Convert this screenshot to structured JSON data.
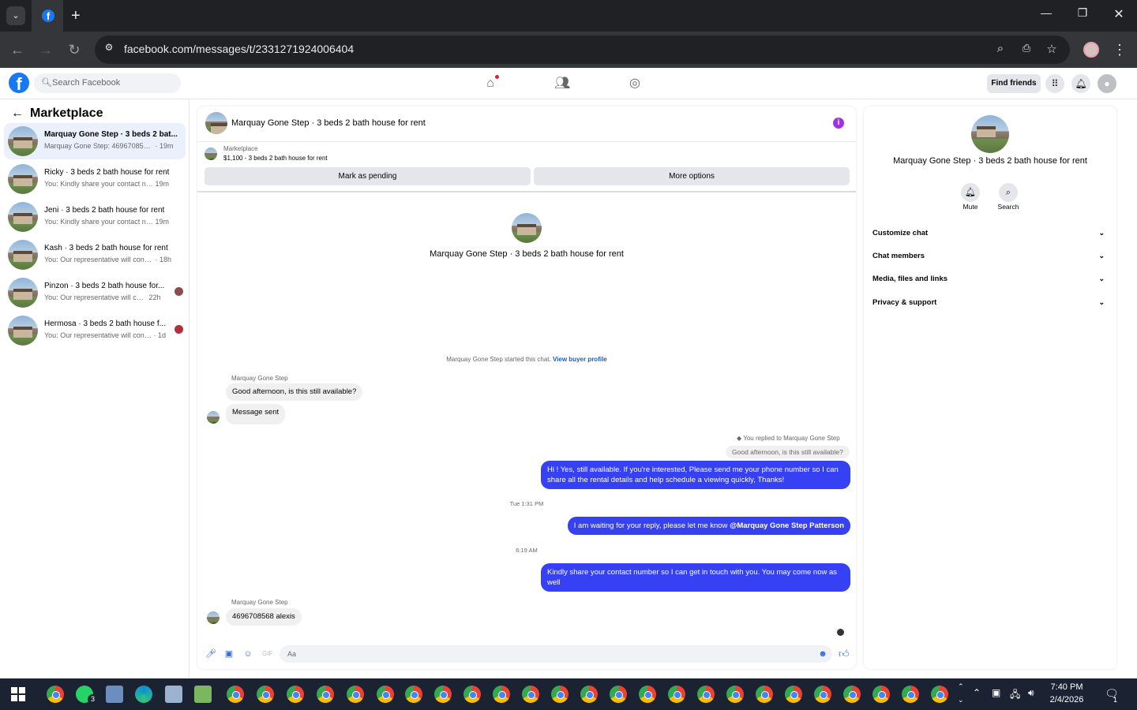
{
  "browser": {
    "url": "facebook.com/messages/t/2331271924006404"
  },
  "facebook": {
    "search_placeholder": "Search Facebook",
    "find_friends": "Find friends"
  },
  "sidebar": {
    "title": "Marketplace",
    "conversations": [
      {
        "name": "Marquay Gone Step · 3 beds 2 bat...",
        "preview": "Marquay Gone Step: 4696708568 al...",
        "time": "· 19m",
        "active": true
      },
      {
        "name": "Ricky · 3 beds 2 bath house for rent",
        "preview": "You: Kindly share your contact num...",
        "time": "19m"
      },
      {
        "name": "Jeni · 3 beds 2 bath house for rent",
        "preview": "You: Kindly share your contact num...",
        "time": "19m"
      },
      {
        "name": "Kash · 3 beds 2 bath house for rent",
        "preview": "You: Our representative will contact ...",
        "time": "· 18h"
      },
      {
        "name": "Pinzon · 3 beds 2 bath house for...",
        "preview": "You: Our representative will conta...",
        "time": "22h"
      },
      {
        "name": "Hermosa · 3 beds 2 bath house f...",
        "preview": "You: Our representative will contac...",
        "time": "· 1d"
      }
    ]
  },
  "chat": {
    "header_title": "Marquay Gone Step · 3 beds 2 bath house for rent",
    "marketplace_label": "Marketplace",
    "listing": "$1,100 - 3 beds 2 bath house for rent",
    "mark_pending": "Mark as pending",
    "more_options": "More options",
    "intro_name": "Marquay Gone Step · 3 beds 2 bath house for rent",
    "started_text": "Marquay Gone Step started this chat.",
    "view_profile": "View buyer profile",
    "sender_name": "Marquay Gone Step",
    "msg_in_1": "Good afternoon, is this still available?",
    "msg_in_2": "Message sent",
    "replied_label": "You replied to Marquay Gone Step",
    "quote": "Good afternoon, is this still available?",
    "msg_out_1": "Hi ! Yes, still available. If you're interested, Please send me your phone number so I can share all the rental details and help schedule a viewing quickly, Thanks!",
    "ts_1": "Tue 1:31 PM",
    "msg_out_2a": "I am waiting for your reply, please let me know ",
    "msg_out_2b": "@Marquay Gone Step Patterson",
    "ts_2": "6:19 AM",
    "msg_out_3": "Kindly share your contact number so I can get in touch with you. You may come now as well",
    "sender_name_2": "Marquay Gone Step",
    "msg_in_3": "4696708568 alexis",
    "composer_placeholder": "Aa"
  },
  "details": {
    "name": "Marquay Gone Step · 3 beds 2 bath house for rent",
    "mute": "Mute",
    "search": "Search",
    "rows": [
      "Customize chat",
      "Chat members",
      "Media, files and links",
      "Privacy & support"
    ]
  },
  "taskbar": {
    "time": "7:40 PM",
    "date": "2/4/2026",
    "whatsapp_badge": "3",
    "notif_count": "1"
  }
}
